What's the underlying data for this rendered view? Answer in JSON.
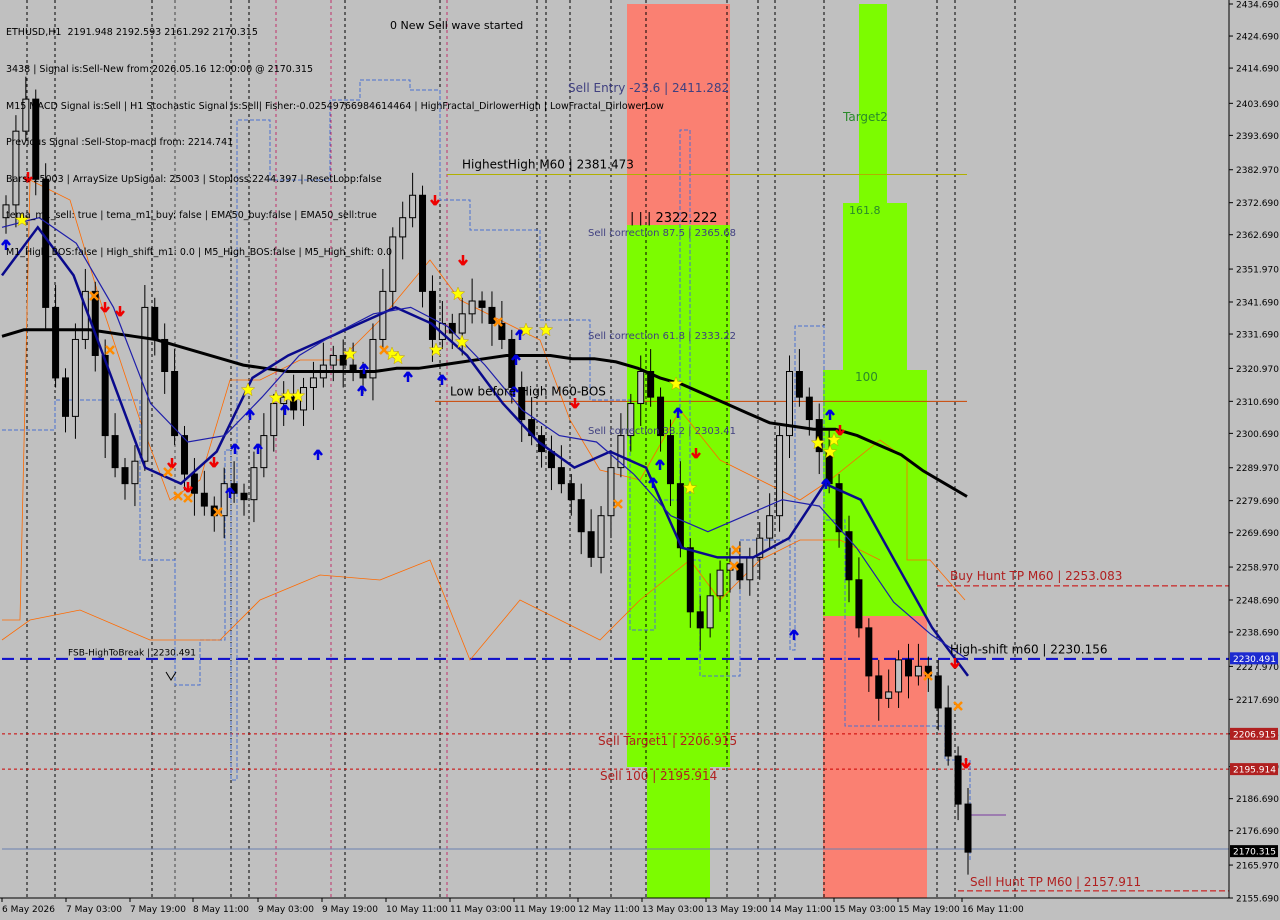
{
  "symbol_header": "ETHUSD,H1  2191.948 2192.593 2161.292 2170.315",
  "info_lines": [
    "3438 | Signal is:Sell-New from:2026.05.16 12:00:00 @ 2170.315",
    "M15 MACD Signal is:Sell | H1 Stochastic Signal is:Sell| Fisher:-0.02549766984614464 | HighFractal_DirlowerHigh | LowFractal_DirlowerLow",
    "Previous Signal :Sell-Stop-macd from: 2214.741",
    "Bars: 25003 | ArraySize UpSignal: 25003 | Stoploss:2244.397 | ResetLoop:false",
    "tema_m1_sell: true | tema_m1_buy: false | EMA50_buy:false | EMA50_sell:true",
    "M1_High_BOS:false | High_shift_m1: 0.0 | M5_High_BOS:false | M5_High_shift: 0.0"
  ],
  "wave_note": "0 New Sell wave started",
  "chart_data": {
    "type": "candlestick",
    "symbol": "ETHUSD",
    "timeframe": "H1",
    "ohlc_last": {
      "open": 2191.948,
      "high": 2192.593,
      "low": 2161.292,
      "close": 2170.315
    },
    "ylim": [
      2155.69,
      2434.69
    ],
    "y_ticks": [
      "2434.690",
      "2424.690",
      "2414.690",
      "2403.690",
      "2393.690",
      "2382.970",
      "2372.690",
      "2362.690",
      "2351.970",
      "2341.690",
      "2331.690",
      "2320.970",
      "2310.690",
      "2300.690",
      "2289.970",
      "2279.690",
      "2269.690",
      "2258.970",
      "2248.690",
      "2238.690",
      "2227.970",
      "2217.690",
      "2206.915",
      "2196.690",
      "2186.690",
      "2176.690",
      "2165.970",
      "2155.690"
    ],
    "x_ticks": [
      "6 May 2026",
      "7 May 03:00",
      "7 May 19:00",
      "8 May 11:00",
      "9 May 03:00",
      "9 May 19:00",
      "10 May 11:00",
      "11 May 03:00",
      "11 May 19:00",
      "12 May 11:00",
      "13 May 03:00",
      "13 May 19:00",
      "14 May 11:00",
      "15 May 03:00",
      "15 May 19:00",
      "16 May 11:00"
    ],
    "close_series": [
      2372,
      2395,
      2405,
      2380,
      2340,
      2318,
      2306,
      2330,
      2345,
      2325,
      2300,
      2290,
      2285,
      2292,
      2340,
      2330,
      2320,
      2300,
      2288,
      2282,
      2278,
      2275,
      2285,
      2282,
      2280,
      2290,
      2300,
      2310,
      2312,
      2308,
      2315,
      2318,
      2322,
      2325,
      2322,
      2320,
      2318,
      2330,
      2345,
      2362,
      2368,
      2375,
      2345,
      2330,
      2335,
      2332,
      2338,
      2342,
      2340,
      2335,
      2330,
      2315,
      2305,
      2300,
      2295,
      2290,
      2285,
      2280,
      2270,
      2262,
      2275,
      2290,
      2300,
      2310,
      2320,
      2312,
      2300,
      2285,
      2265,
      2245,
      2240,
      2250,
      2258,
      2260,
      2255,
      2262,
      2268,
      2275,
      2300,
      2320,
      2312,
      2305,
      2295,
      2285,
      2270,
      2255,
      2240,
      2225,
      2218,
      2220,
      2230,
      2225,
      2228,
      2225,
      2215,
      2200,
      2185,
      2170
    ],
    "moving_averages": [
      {
        "name": "MA black",
        "color": "#000000",
        "values": [
          2331,
          2333,
          2333,
          2333,
          2333,
          2332,
          2331,
          2330,
          2328,
          2326,
          2324,
          2322,
          2321,
          2320,
          2320,
          2320,
          2320,
          2320,
          2321,
          2321,
          2322,
          2323,
          2324,
          2325,
          2325,
          2325,
          2324,
          2324,
          2323,
          2321,
          2318,
          2316,
          2313,
          2310,
          2307,
          2304,
          2303,
          2302,
          2302,
          2300,
          2297,
          2294,
          2289,
          2285,
          2281
        ]
      },
      {
        "name": "MA navy thick",
        "color": "#0a0a8c",
        "values": [
          2350,
          2365,
          2350,
          2320,
          2290,
          2285,
          2295,
          2318,
          2325,
          2330,
          2335,
          2340,
          2335,
          2325,
          2310,
          2298,
          2290,
          2295,
          2290,
          2265,
          2262,
          2262,
          2268,
          2285,
          2280,
          2260,
          2240,
          2225
        ]
      },
      {
        "name": "MA navy thin",
        "color": "#1e1eaa",
        "values": [
          2365,
          2368,
          2360,
          2340,
          2310,
          2298,
          2300,
          2312,
          2325,
          2332,
          2338,
          2340,
          2334,
          2322,
          2308,
          2300,
          2298,
          2288,
          2275,
          2270,
          2275,
          2280,
          2278,
          2265,
          2248,
          2238,
          2230
        ]
      }
    ],
    "horizontal_levels": [
      {
        "label": "HighestHigh   M60 | 2381.473",
        "value": 2381.473,
        "color": "#b0b000"
      },
      {
        "label": "Low before High   M60-BOS",
        "value": 2310.69,
        "color": "#cc4400"
      },
      {
        "label": "Buy Hunt TP M60 | 2253.083",
        "value": 2253.083,
        "color": "#cc0000"
      },
      {
        "label": "High-shift m60 | 2230.156",
        "value": 2230.156,
        "color": "#0000cc"
      },
      {
        "label": "FSB-HighToBreak   | 2230.491",
        "value": 2230.491,
        "color": "#0000cc"
      },
      {
        "label": "Sell Target1 | 2206.915",
        "value": 2206.915,
        "color": "#cc0000"
      },
      {
        "label": "Sell 100 | 2195.914",
        "value": 2195.914,
        "color": "#cc0000"
      },
      {
        "label": "Sell Hunt TP M60 | 2157.911",
        "value": 2157.911,
        "color": "#cc0000"
      }
    ],
    "price_tags": [
      {
        "text": "2230.491",
        "value": 2230.491,
        "bg": "#1c2ad0"
      },
      {
        "text": "2206.915",
        "value": 2206.915,
        "bg": "#b02020"
      },
      {
        "text": "2195.914",
        "value": 2195.914,
        "bg": "#b02020"
      },
      {
        "text": "2170.315",
        "value": 2170.315,
        "bg": "#000000"
      }
    ],
    "zone_labels": [
      {
        "text": "Sell Entry -23.6 | 2411.282",
        "color": "#404080"
      },
      {
        "text": "| | | 2322.222",
        "color": "#000000"
      },
      {
        "text": "Sell correction 87.5 | 2365.68",
        "color": "#404080"
      },
      {
        "text": "Sell correction 61.8 | 2333.22",
        "color": "#404080"
      },
      {
        "text": "Sell correction 38.2 | 2303.41",
        "color": "#404080"
      },
      {
        "text": "Target2",
        "color": "#2a8a2a"
      },
      {
        "text": "161.8",
        "color": "#2a8a2a"
      },
      {
        "text": "100",
        "color": "#2a8a2a"
      }
    ],
    "colors": {
      "background": "#c0c0c0",
      "sell_zone": "#fa8072",
      "buy_zone": "#7cfc00",
      "up_arrow": "#0000dd",
      "down_arrow": "#ee0000",
      "star": "#ffff00",
      "orange_x": "#ff8c00"
    },
    "grid": false
  }
}
